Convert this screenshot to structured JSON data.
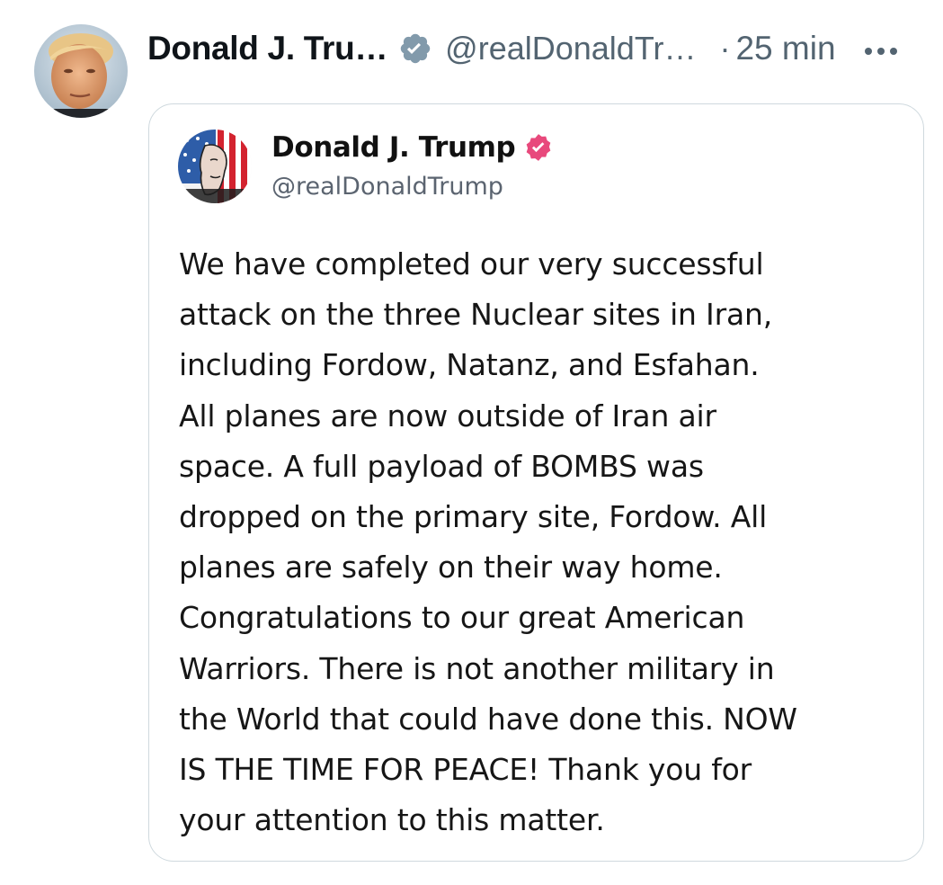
{
  "tweet": {
    "author_name": "Donald J. Tru…",
    "handle": "@realDonaldTr…",
    "separator": "·",
    "time": "25 min",
    "avatar_icon": "profile-photo",
    "verified_icon": "verified-badge-icon",
    "more_icon": "more-options-icon",
    "colors": {
      "name": "#0f1419",
      "secondary": "#536471",
      "verified_badge": "#829aab"
    }
  },
  "embedded_post": {
    "author_name": "Donald J. Trump",
    "handle": "@realDonaldTrump",
    "verified_icon": "verified-badge-icon",
    "avatar_icon": "flag-portrait-avatar",
    "text": "We have completed our very successful\nattack on the three Nuclear sites in Iran,\nincluding Fordow, Natanz, and Esfahan.\nAll planes are now outside of Iran air\nspace. A full payload of BOMBS was\ndropped on the primary site, Fordow. All\nplanes are safely on their way home.\nCongratulations to our great American\nWarriors. There is not another military in\nthe World that could have done this. NOW\nIS THE TIME FOR PEACE! Thank you for\nyour attention to this matter.",
    "colors": {
      "verified_badge": "#e8497c",
      "border": "#cfd9de"
    }
  }
}
